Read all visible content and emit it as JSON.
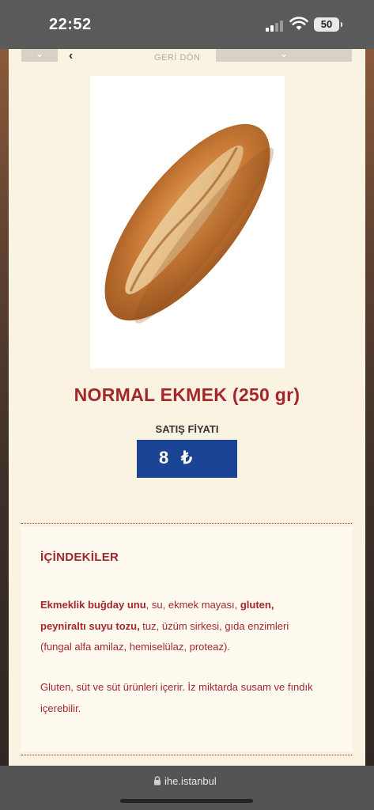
{
  "status_bar": {
    "time": "22:52",
    "battery": "50"
  },
  "nav": {
    "back_label": "GERİ DÖN",
    "back_icon": "chevron-left-icon",
    "dropdown_icon": "chevron-down-icon"
  },
  "product": {
    "image": "bread-loaf",
    "title": "NORMAL EKMEK (250 gr)",
    "price_label": "SATIŞ FİYATI",
    "price_value": "8",
    "price_currency": "₺"
  },
  "ingredients": {
    "heading": "İÇİNDEKİLER",
    "text_parts": {
      "p1_bold": "Ekmeklik buğday unu",
      "p1_normal": ", su, ekmek mayası, ",
      "p2_bold": "gluten, peyniraltı suyu tozu,",
      "p2_normal": " tuz, üzüm sirkesi, gıda enzimleri (fungal alfa amilaz, hemiselülaz, proteaz)."
    },
    "allergen": "Gluten, süt ve süt ürünleri içerir. İz miktarda susam ve fındık içerebilir."
  },
  "browser": {
    "url": "ihe.istanbul"
  },
  "colors": {
    "accent_red": "#a4262c",
    "price_blue": "#1b4495",
    "page_cream": "#fbf3e2"
  }
}
